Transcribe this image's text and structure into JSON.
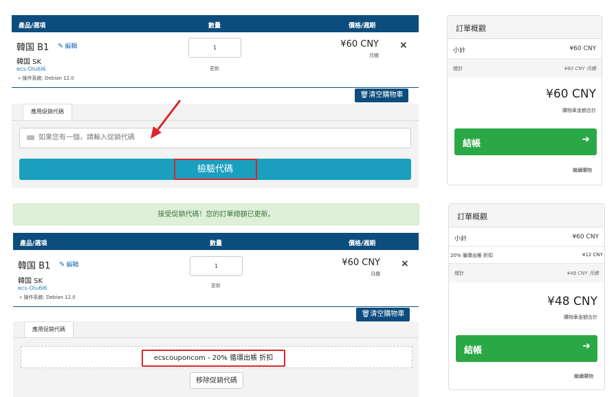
{
  "table_header": {
    "product": "產品/選項",
    "qty": "數量",
    "price": "價格/週期"
  },
  "item": {
    "name": "韓国 B1",
    "edit": "編輯",
    "group": "韓国 SK",
    "hostname": "ecs-Olu6l6",
    "os": "» 操作系統: Debian 12.0",
    "qty": "1",
    "update": "更新",
    "price": "¥60 CNY",
    "period": "月繳",
    "remove": "×"
  },
  "clear_cart": "清空購物車",
  "promo": {
    "tab": "應用促銷代碼",
    "placeholder": "如果您有一個，請輸入促銷代碼",
    "validate": "檢驗代碼",
    "success": "接受促銷代碼！您的訂單總額已更新。",
    "applied": "ecscouponcom - 20% 循環出帳 折扣",
    "remove": "移除促銷代碼"
  },
  "summary1": {
    "title": "訂單概觀",
    "subtotal_label": "小計",
    "subtotal": "¥60 CNY",
    "total_label": "總計",
    "total_small": "¥60 CNY 月繳",
    "total": "¥60 CNY",
    "total_caption": "購物車金額合計",
    "checkout": "結帳",
    "continue": "繼續購物"
  },
  "summary2": {
    "title": "訂單概觀",
    "subtotal_label": "小計",
    "subtotal": "¥60 CNY",
    "discount_label": "20% 循環出帳 折扣",
    "discount": "¥12 CNY",
    "total_label": "總計",
    "total_small": "¥48 CNY 月繳",
    "total": "¥48 CNY",
    "total_caption": "購物車金額合計",
    "checkout": "結帳",
    "continue": "繼續購物"
  },
  "colors": {
    "header": "#0d4d7d",
    "validate": "#1aa0be",
    "checkout": "#2aa845",
    "highlight": "#d9262b"
  }
}
